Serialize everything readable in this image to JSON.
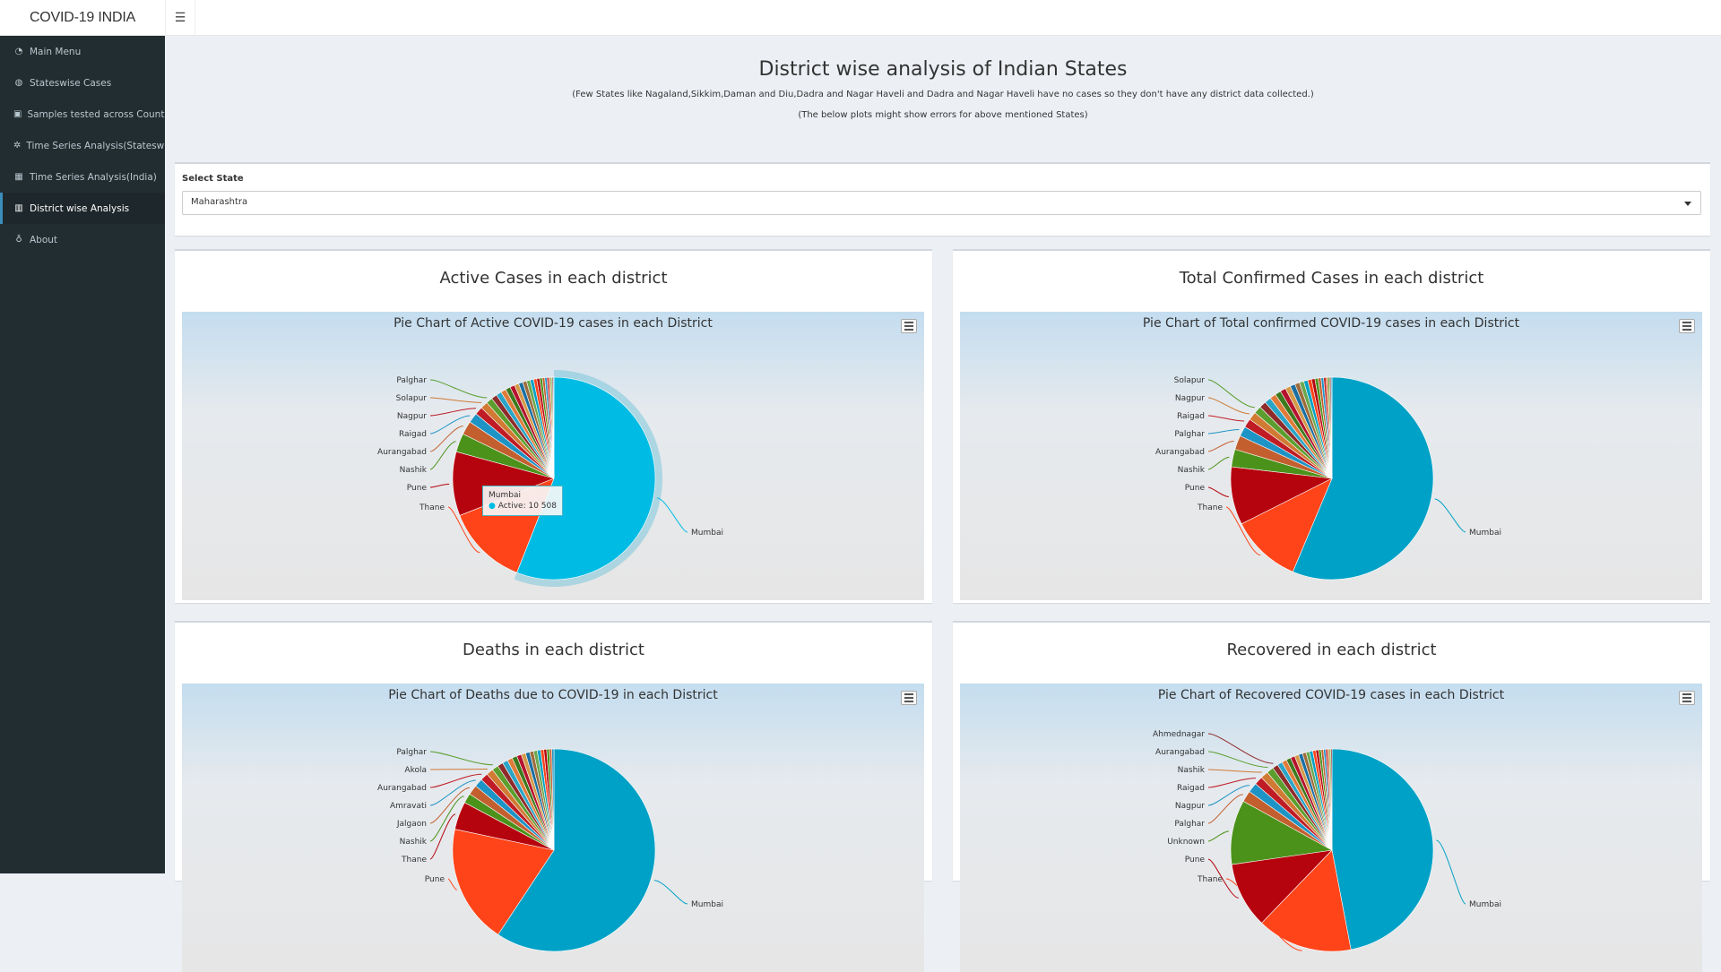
{
  "app": {
    "brand": "COVID-19 INDIA",
    "toggle_icon": "hamburger-icon"
  },
  "sidebar": {
    "items": [
      {
        "label": "Main Menu",
        "icon": "dashboard-icon",
        "glyph": "◔"
      },
      {
        "label": "Stateswise Cases",
        "icon": "globe-icon",
        "glyph": "◍"
      },
      {
        "label": "Samples tested across Country",
        "icon": "hospital-icon",
        "glyph": "▣"
      },
      {
        "label": "Time Series Analysis(Stateswise)",
        "icon": "gear-icon",
        "glyph": "✲"
      },
      {
        "label": "Time Series Analysis(India)",
        "icon": "calendar-icon",
        "glyph": "▦"
      },
      {
        "label": "District wise Analysis",
        "icon": "map-icon",
        "glyph": "▥"
      },
      {
        "label": "About",
        "icon": "award-icon",
        "glyph": "♁"
      }
    ],
    "active_index": 5
  },
  "header": {
    "title": "District wise analysis of Indian States",
    "note": "(Few States like Nagaland,Sikkim,Daman and Diu,Dadra and Nagar Haveli and Dadra and Nagar Haveli have no cases so they don't have any district data collected.)",
    "note2": "(The below plots might show errors for above mentioned States)"
  },
  "select_state": {
    "label": "Select State",
    "value": "Maharashtra"
  },
  "panels": [
    {
      "title": "Active Cases in each district",
      "chart_title": "Pie Chart of Active COVID-19 cases in each District"
    },
    {
      "title": "Total Confirmed Cases in each district",
      "chart_title": "Pie Chart of Total confirmed COVID-19 cases in each District"
    },
    {
      "title": "Deaths in each district",
      "chart_title": "Pie Chart of Deaths due to COVID-19 in each District"
    },
    {
      "title": "Recovered in each district",
      "chart_title": "Pie Chart of Recovered COVID-19 cases in each District"
    }
  ],
  "tooltip": {
    "name": "Mumbai",
    "text": "Active: 10 508"
  },
  "colors": {
    "accent": "#3c8dbc",
    "sidebar": "#222d32",
    "mumbai": "#00a1c6",
    "mumbai_hover": "#00bce4",
    "thane": "#ff4419",
    "pune": "#b6040f",
    "green": "#4b921a"
  },
  "chart_data": [
    {
      "type": "pie",
      "title": "Pie Chart of Active COVID-19 cases in each District",
      "categories": [
        "Mumbai",
        "Thane",
        "Pune",
        "Nashik",
        "Aurangabad",
        "Raigad",
        "Nagpur",
        "Solapur",
        "Palghar"
      ],
      "values": [
        10508,
        2450,
        1920,
        560,
        410,
        300,
        240,
        220,
        190
      ],
      "others_count": 20,
      "highlighted": "Mumbai"
    },
    {
      "type": "pie",
      "title": "Pie Chart of Total confirmed COVID-19 cases in each District",
      "categories": [
        "Mumbai",
        "Thane",
        "Pune",
        "Nashik",
        "Aurangabad",
        "Palghar",
        "Raigad",
        "Nagpur",
        "Solapur"
      ],
      "values": [
        14000,
        2800,
        2300,
        700,
        560,
        400,
        350,
        330,
        300
      ],
      "others_count": 20
    },
    {
      "type": "pie",
      "title": "Pie Chart of Deaths due to COVID-19 in each District",
      "categories": [
        "Mumbai",
        "Pune",
        "Thane",
        "Nashik",
        "Jalgaon",
        "Amravati",
        "Aurangabad",
        "Akola",
        "Palghar"
      ],
      "values": [
        530,
        170,
        40,
        14,
        14,
        12,
        11,
        10,
        9
      ],
      "others_count": 15
    },
    {
      "type": "pie",
      "title": "Pie Chart of Recovered COVID-19 cases in each District",
      "categories": [
        "Mumbai",
        "Thane",
        "Pune",
        "Unknown",
        "Palghar",
        "Nagpur",
        "Raigad",
        "Nashik",
        "Aurangabad",
        "Ahmednagar"
      ],
      "values": [
        2100,
        680,
        470,
        460,
        80,
        70,
        60,
        55,
        50,
        40
      ],
      "others_count": 18
    }
  ]
}
